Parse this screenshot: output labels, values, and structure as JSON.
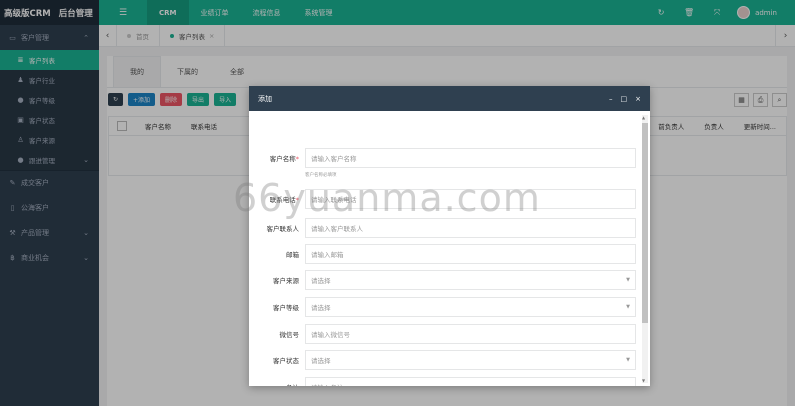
{
  "brand": {
    "part1": "高级版CRM",
    "part2": "后台管理"
  },
  "sidebar": {
    "items": [
      {
        "label": "客户管理",
        "icon": "id-card-icon",
        "chev": "⌃"
      },
      {
        "label": "客户列表",
        "icon": "list-icon"
      },
      {
        "label": "客户行业",
        "icon": "user-icon"
      },
      {
        "label": "客户等级",
        "icon": "star-circle-icon"
      },
      {
        "label": "客户状态",
        "icon": "card-icon"
      },
      {
        "label": "客户来源",
        "icon": "walk-icon"
      },
      {
        "label": "跟进管理",
        "icon": "comment-icon",
        "chev": "⌄"
      },
      {
        "label": "成交客户",
        "icon": "edit-icon"
      },
      {
        "label": "公海客户",
        "icon": "file-icon"
      },
      {
        "label": "产品管理",
        "icon": "gavel-icon",
        "chev": "⌄"
      },
      {
        "label": "商业机会",
        "icon": "bitcoin-icon",
        "chev": "⌄"
      }
    ]
  },
  "topbar": {
    "toggle": "☰",
    "nav": [
      "CRM",
      "业绩订单",
      "流程信息",
      "系统管理"
    ],
    "username": "admin"
  },
  "tabs": {
    "left_arrow": "‹",
    "right_arrow": "›",
    "items": [
      {
        "label": "首页"
      },
      {
        "label": "客户列表",
        "close": "×"
      }
    ]
  },
  "page": {
    "subtabs": [
      "我的",
      "下属的",
      "全部"
    ],
    "toolbar": {
      "refresh": "↻",
      "add": "+添加",
      "delete": "删除",
      "export": "导出",
      "import": "导入"
    },
    "columns": [
      "客户名称",
      "联系电话",
      "前负责人",
      "负责人",
      "更新时间..."
    ]
  },
  "modal": {
    "title": "添加",
    "controls": {
      "min": "–",
      "max": "□",
      "close": "×"
    },
    "hint": "客户名称必填项",
    "fields": [
      {
        "label": "客户名称",
        "required": "*",
        "placeholder": "请输入客户名称"
      },
      {
        "label": "联系电话",
        "required": "*",
        "placeholder": "请输入联系电话"
      },
      {
        "label": "客户联系人",
        "required": "",
        "placeholder": "请输入客户联系人"
      },
      {
        "label": "邮箱",
        "required": "",
        "placeholder": "请输入邮箱"
      },
      {
        "label": "客户来源",
        "required": "",
        "placeholder": "请选择"
      },
      {
        "label": "客户等级",
        "required": "",
        "placeholder": "请选择"
      },
      {
        "label": "微信号",
        "required": "",
        "placeholder": "请输入微信号"
      },
      {
        "label": "客户状态",
        "required": "",
        "placeholder": "请选择"
      },
      {
        "label": "备注",
        "required": "",
        "placeholder": "请输入备注"
      }
    ]
  },
  "watermark": "66yuanma.com",
  "colors": {
    "accent": "#1ab394",
    "sidebar": "#2f4050",
    "header": "#2f4050"
  }
}
